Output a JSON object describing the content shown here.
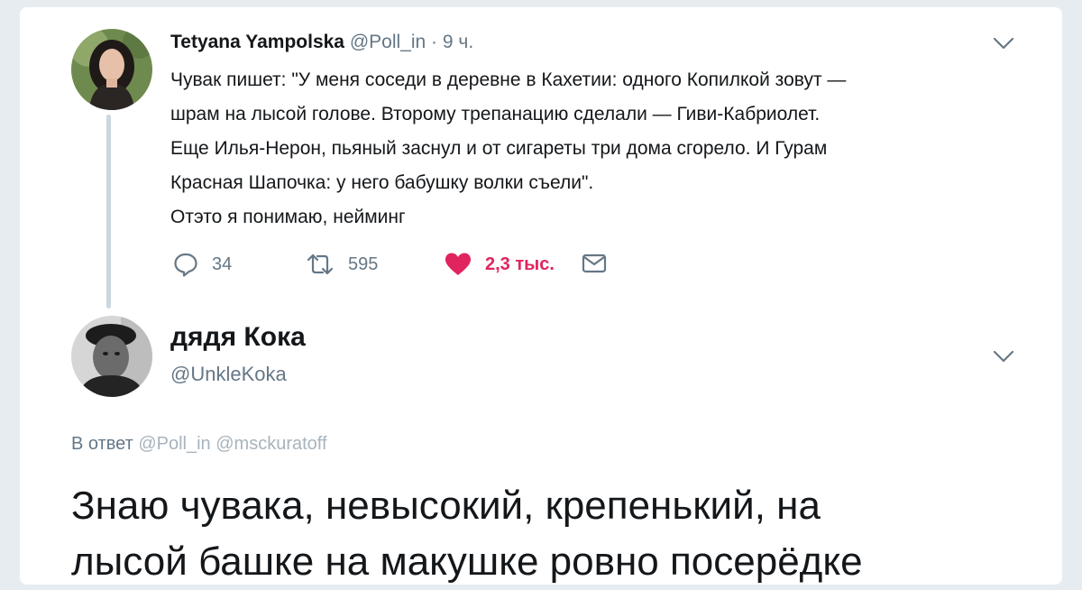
{
  "colors": {
    "background": "#e6ecf0",
    "card": "#ffffff",
    "text": "#14171a",
    "muted": "#657786",
    "like": "#e0245e",
    "thread_line": "#ccd6dd"
  },
  "tweet1": {
    "author_name": "Tetyana Yampolska",
    "handle": "@Poll_in",
    "separator": "·",
    "time": "9 ч.",
    "text_lines": [
      "Чувак пишет: \"У меня соседи в деревне в Кахетии: одного Копилкой зовут —",
      "шрам на лысой голове. Второму трепанацию сделали — Гиви-Кабриолет.",
      "Еще Илья-Нерон, пьяный заснул и от сигареты три дома сгорело. И Гурам",
      "Красная Шапочка: у него бабушку волки съели\".",
      "Отэто я понимаю, нейминг"
    ],
    "actions": {
      "reply": {
        "icon": "reply-icon",
        "count": "34"
      },
      "retweet": {
        "icon": "retweet-icon",
        "count": "595"
      },
      "like": {
        "icon": "heart-icon",
        "count": "2,3 тыс."
      },
      "dm": {
        "icon": "envelope-icon"
      }
    },
    "menu_icon": "chevron-down-icon"
  },
  "tweet2": {
    "author_name": "дядя Кока",
    "handle": "@UnkleKoka",
    "menu_icon": "chevron-down-icon",
    "reply_to_label": "В ответ",
    "reply_to_mentions": [
      "@Poll_in",
      "@msckuratoff"
    ],
    "text_lines": [
      "Знаю чувака, невысокий, крепенький, на",
      "лысой башке на макушке ровно посерёдке"
    ]
  }
}
